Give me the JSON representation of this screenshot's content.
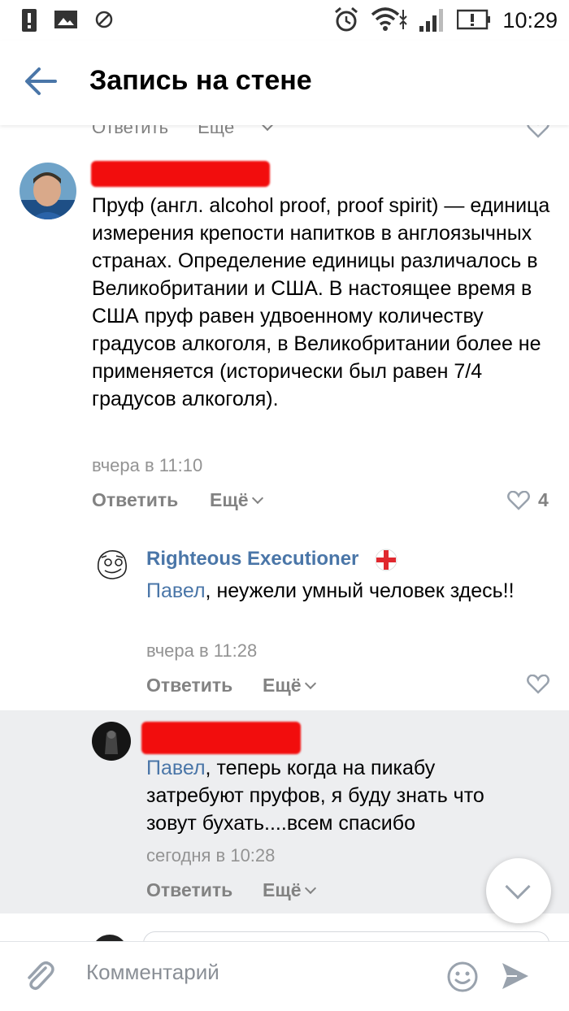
{
  "statusbar": {
    "time": "10:29",
    "icons": [
      "alert-icon",
      "image-icon",
      "blocked-icon",
      "alarm-icon",
      "wifi-icon",
      "signal-icon",
      "battery-icon"
    ]
  },
  "header": {
    "title": "Запись на стене",
    "back_icon": "arrow-left-icon"
  },
  "prev_actions": {
    "reply": "Ответить",
    "more": "Ещё"
  },
  "comments": [
    {
      "author_redacted": true,
      "text": "Пруф (англ. alcohol proof, proof spirit) — единица измерения крепости напитков в англоязычных странах. Определение единицы различалось в Великобритании и США. В настоящее время в США пруф равен удвоенному количеству градусов алкоголя, в Великобритании более не применяется (исторически был равен 7/4 градусов алкоголя).",
      "time": "вчера в 11:10",
      "reply": "Ответить",
      "more": "Ещё",
      "likes": "4"
    },
    {
      "author": "Righteous Executioner",
      "mention": "Павел",
      "text": ", неужели умный человек здесь!!",
      "time": "вчера в 11:28",
      "reply": "Ответить",
      "more": "Ещё"
    },
    {
      "author_redacted": true,
      "mention": "Павел",
      "text": ", теперь когда на пикабу затребуют пруфов, я буду знать что зовут бухать....всем спасибо",
      "time": "сегодня в 10:28",
      "reply": "Ответить",
      "more": "Ещё"
    }
  ],
  "footer": {
    "placeholder": "Комментарий",
    "attach_icon": "paperclip-icon",
    "emoji_icon": "smile-icon",
    "send_icon": "send-icon"
  },
  "colors": {
    "accent": "#4a76a8",
    "muted": "#828282",
    "highlight_bg": "#edeef0",
    "redaction": "#f20d0d"
  }
}
